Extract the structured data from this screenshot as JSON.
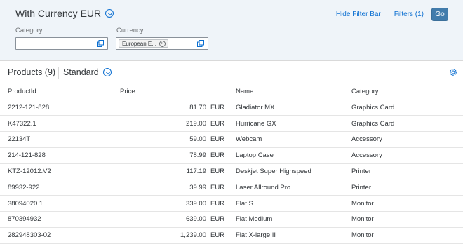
{
  "filter_bar": {
    "variant_title": "With Currency EUR",
    "hide_filter_bar": "Hide Filter Bar",
    "filters": "Filters (1)",
    "go": "Go",
    "category_label": "Category:",
    "category_value": "",
    "currency_label": "Currency:",
    "currency_token": "European E..."
  },
  "table_toolbar": {
    "title": "Products (9)",
    "variant": "Standard"
  },
  "table": {
    "columns": [
      "ProductId",
      "Price",
      "Name",
      "Category"
    ],
    "rows": [
      {
        "id": "2212-121-828",
        "price": "81.70",
        "currency": "EUR",
        "name": "Gladiator MX",
        "category": "Graphics Card"
      },
      {
        "id": "K47322.1",
        "price": "219.00",
        "currency": "EUR",
        "name": "Hurricane GX",
        "category": "Graphics Card"
      },
      {
        "id": "22134T",
        "price": "59.00",
        "currency": "EUR",
        "name": "Webcam",
        "category": "Accessory"
      },
      {
        "id": "214-121-828",
        "price": "78.99",
        "currency": "EUR",
        "name": "Laptop Case",
        "category": "Accessory"
      },
      {
        "id": "KTZ-12012.V2",
        "price": "117.19",
        "currency": "EUR",
        "name": "Deskjet Super Highspeed",
        "category": "Printer"
      },
      {
        "id": "89932-922",
        "price": "39.99",
        "currency": "EUR",
        "name": "Laser Allround Pro",
        "category": "Printer"
      },
      {
        "id": "38094020.1",
        "price": "339.00",
        "currency": "EUR",
        "name": "Flat S",
        "category": "Monitor"
      },
      {
        "id": "870394932",
        "price": "639.00",
        "currency": "EUR",
        "name": "Flat Medium",
        "category": "Monitor"
      },
      {
        "id": "282948303-02",
        "price": "1,239.00",
        "currency": "EUR",
        "name": "Flat X-large II",
        "category": "Monitor"
      }
    ]
  },
  "colors": {
    "accent": "#0a6ed1",
    "filter_bar_bg": "#eff4f9",
    "go_button": "#427cac"
  }
}
